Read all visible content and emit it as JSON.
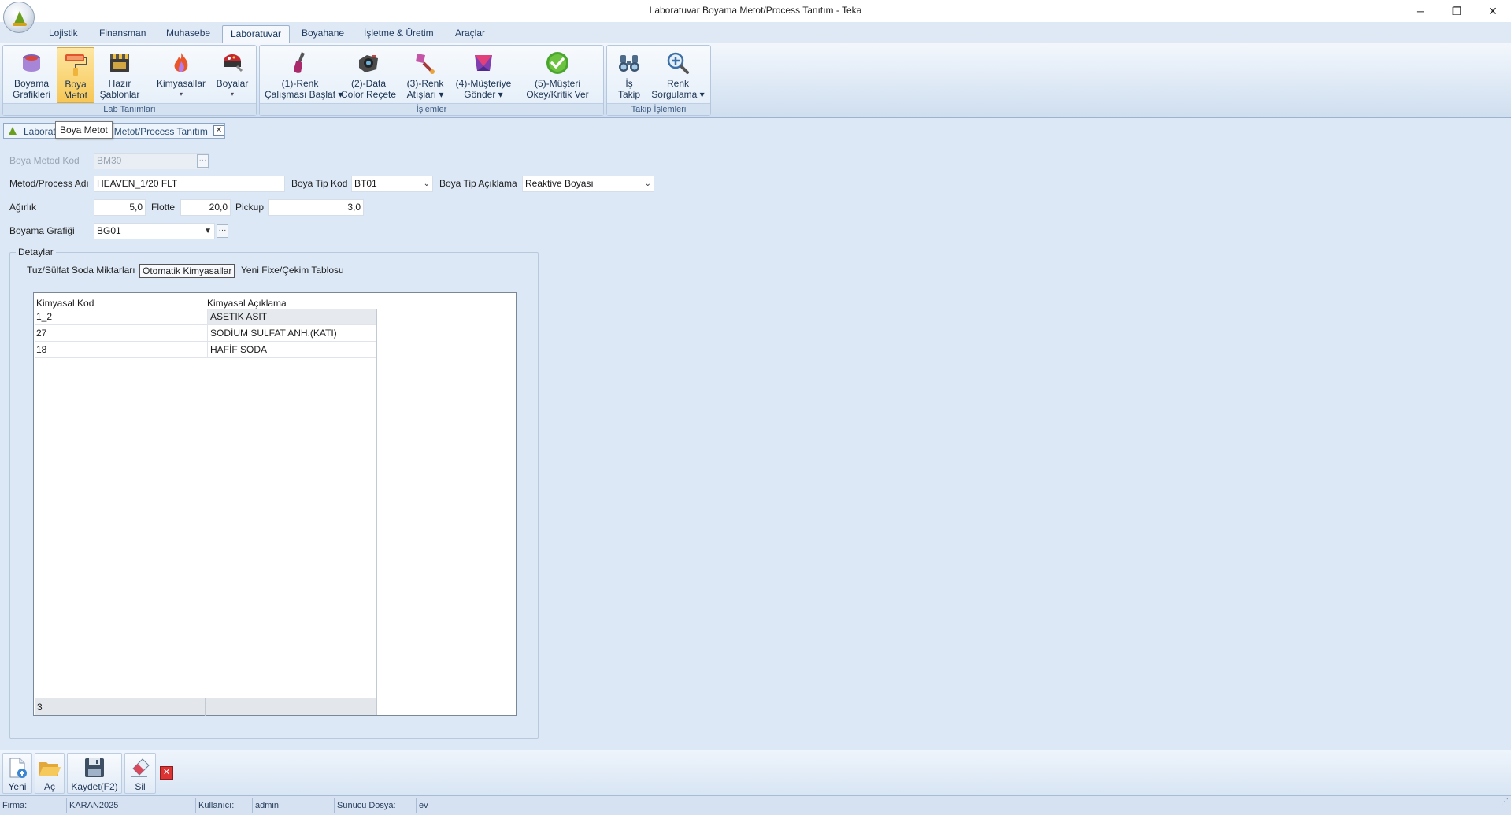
{
  "window": {
    "title": "Laboratuvar Boyama Metot/Process Tanıtım - Teka",
    "minimize": "─",
    "maximize": "❐",
    "close": "✕"
  },
  "menu": {
    "tabs": [
      "Lojistik",
      "Finansman",
      "Muhasebe",
      "Laboratuvar",
      "Boyahane",
      "İşletme & Üretim",
      "Araçlar"
    ],
    "active": "Laboratuvar"
  },
  "ribbon": {
    "groups": {
      "lab": "Lab Tanımları",
      "islemler": "İşlemler",
      "takip": "Takip İşlemleri"
    },
    "buttons": {
      "boyama_grafikleri": [
        "Boyama",
        "Grafikleri"
      ],
      "boya_metot": [
        "Boya",
        "Metot"
      ],
      "hazir_sablonlar": [
        "Hazır",
        "Şablonlar"
      ],
      "kimyasallar": [
        "Kimyasallar",
        "▾"
      ],
      "boyalar": [
        "Boyalar",
        "▾"
      ],
      "renk_calismasi": [
        "(1)-Renk",
        "Çalışması Başlat ▾"
      ],
      "data_color": [
        "(2)-Data",
        "Color Reçete"
      ],
      "renk_atislari": [
        "(3)-Renk",
        "Atışları ▾"
      ],
      "musteriye_gonder": [
        "(4)-Müşteriye",
        "Gönder ▾"
      ],
      "musteri_okey": [
        "(5)-Müşteri",
        "Okey/Kritik Ver"
      ],
      "is_takip": [
        "İş",
        "Takip"
      ],
      "renk_sorgulama": [
        "Renk",
        "Sorgulama ▾"
      ]
    }
  },
  "doc_tab": {
    "title": "Laboratuvar Boyama Metot/Process Tanıtım",
    "close": "✕",
    "tooltip": "Boya Metot"
  },
  "form": {
    "boya_metod_kod_label": "Boya Metod Kod",
    "boya_metod_kod_value": "BM30",
    "metot_adi_label": "Metod/Process Adı",
    "metot_adi_value": "HEAVEN_1/20 FLT",
    "boya_tip_kod_label": "Boya Tip Kod",
    "boya_tip_kod_value": "BT01",
    "boya_tip_aciklama_label": "Boya Tip Açıklama",
    "boya_tip_aciklama_value": "Reaktive Boyası",
    "agirlik_label": "Ağırlık",
    "agirlik_value": "5,0",
    "flotte_label": "Flotte",
    "flotte_value": "20,0",
    "pickup_label": "Pickup",
    "pickup_value": "3,0",
    "boyama_grafigi_label": "Boyama Grafiği",
    "boyama_grafigi_value": "BG01",
    "ellipsis": "···"
  },
  "details": {
    "title": "Detaylar",
    "tabs": [
      "Tuz/Sülfat Soda Miktarları",
      "Otomatik Kimyasallar",
      "Yeni Fixe/Çekim Tablosu"
    ],
    "active_tab": "Otomatik Kimyasallar",
    "grid": {
      "columns": [
        "Kimyasal Kod",
        "Kimyasal Açıklama"
      ],
      "rows": [
        {
          "kod": "1_2",
          "aciklama": "ASETIK ASIT"
        },
        {
          "kod": "27",
          "aciklama": "SODİUM SULFAT ANH.(KATI)"
        },
        {
          "kod": "18",
          "aciklama": "HAFİF SODA"
        }
      ],
      "footer_count": "3"
    }
  },
  "bottom_toolbar": {
    "yeni": "Yeni",
    "ac": "Aç",
    "kaydet": "Kaydet(F2)",
    "sil": "Sil",
    "x": "✕"
  },
  "status": {
    "firma_label": "Firma:",
    "firma_value": "KARAN2025",
    "kullanici_label": "Kullanıcı:",
    "kullanici_value": "admin",
    "sunucu_label": "Sunucu Dosya:",
    "sunucu_value": "ev"
  },
  "colors": {
    "background": "#dce8f6",
    "ribbon_selected": "#f7c755",
    "accent_green": "#6a9e1f"
  }
}
